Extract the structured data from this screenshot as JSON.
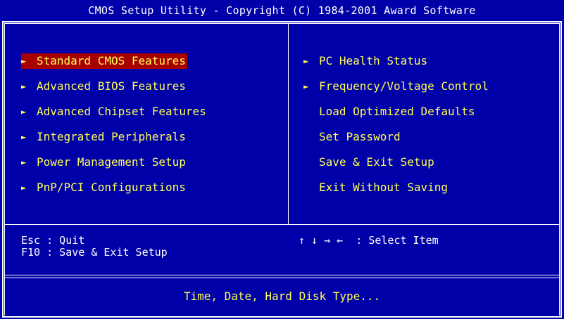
{
  "title": "CMOS Setup Utility - Copyright (C) 1984-2001 Award Software",
  "colors": {
    "background": "#0000a8",
    "text_menu": "#ffff54",
    "text_help": "#ffffff",
    "highlight": "#a80000"
  },
  "menu_left": [
    {
      "label": "Standard CMOS Features",
      "submenu": true,
      "selected": true
    },
    {
      "label": "Advanced BIOS Features",
      "submenu": true
    },
    {
      "label": "Advanced Chipset Features",
      "submenu": true
    },
    {
      "label": "Integrated Peripherals",
      "submenu": true
    },
    {
      "label": "Power Management Setup",
      "submenu": true
    },
    {
      "label": "PnP/PCI Configurations",
      "submenu": true
    }
  ],
  "menu_right": [
    {
      "label": "PC Health Status",
      "submenu": true
    },
    {
      "label": "Frequency/Voltage Control",
      "submenu": true
    },
    {
      "label": "Load Optimized Defaults",
      "submenu": false
    },
    {
      "label": "Set Password",
      "submenu": false
    },
    {
      "label": "Save & Exit Setup",
      "submenu": false
    },
    {
      "label": "Exit Without Saving",
      "submenu": false
    }
  ],
  "arrow_glyph": "►",
  "help": {
    "esc": "Esc : Quit",
    "f10": "F10 : Save & Exit Setup",
    "nav_keys": "↑ ↓ → ←",
    "nav_text": "  : Select Item"
  },
  "status": "Time, Date, Hard Disk Type..."
}
